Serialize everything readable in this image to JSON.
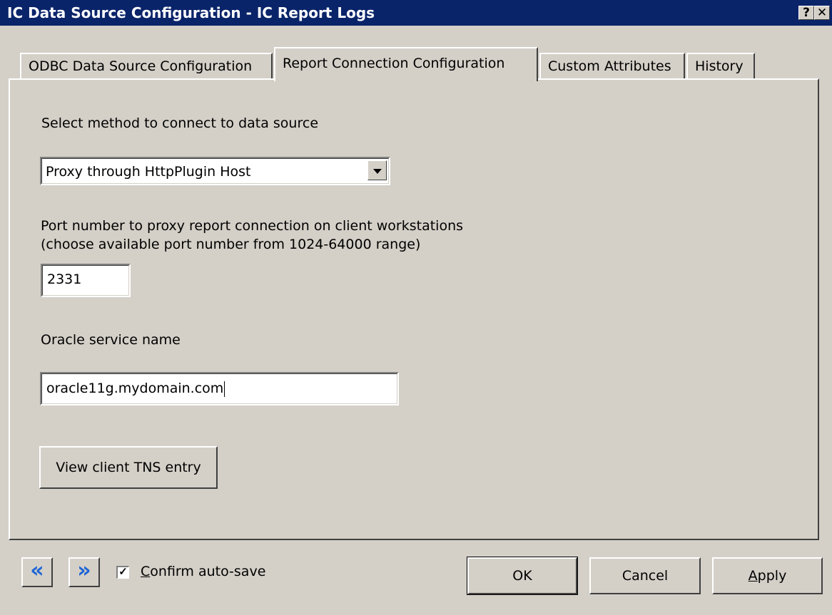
{
  "window": {
    "title": "IC Data Source Configuration - IC Report Logs",
    "help_glyph": "?",
    "close_glyph": "✕"
  },
  "tabs": [
    {
      "label": "ODBC Data Source Configuration",
      "active": false
    },
    {
      "label": "Report Connection Configuration",
      "active": true
    },
    {
      "label": "Custom Attributes",
      "active": false
    },
    {
      "label": "History",
      "active": false
    }
  ],
  "connection": {
    "method_label": "Select method to connect to data source",
    "method_value": "Proxy through HttpPlugin Host",
    "port_label_line1": "Port number to proxy report connection on client workstations",
    "port_label_line2": "(choose available port number from 1024-64000 range)",
    "port_value": "2331",
    "service_label": "Oracle service name",
    "service_value": "oracle11g.mydomain.com",
    "view_tns_button": "View client TNS entry"
  },
  "footer": {
    "prev_glyph": "«",
    "next_glyph": "»",
    "confirm_checked_glyph": "✓",
    "confirm_label_first": "C",
    "confirm_label_rest": "onfirm auto-save",
    "ok_label": "OK",
    "cancel_label": "Cancel",
    "apply_label_first": "A",
    "apply_label_rest": "pply"
  },
  "colors": {
    "titlebar": "#0a246a",
    "face": "#d4d0c8",
    "nav_arrow": "#1e64d4"
  }
}
